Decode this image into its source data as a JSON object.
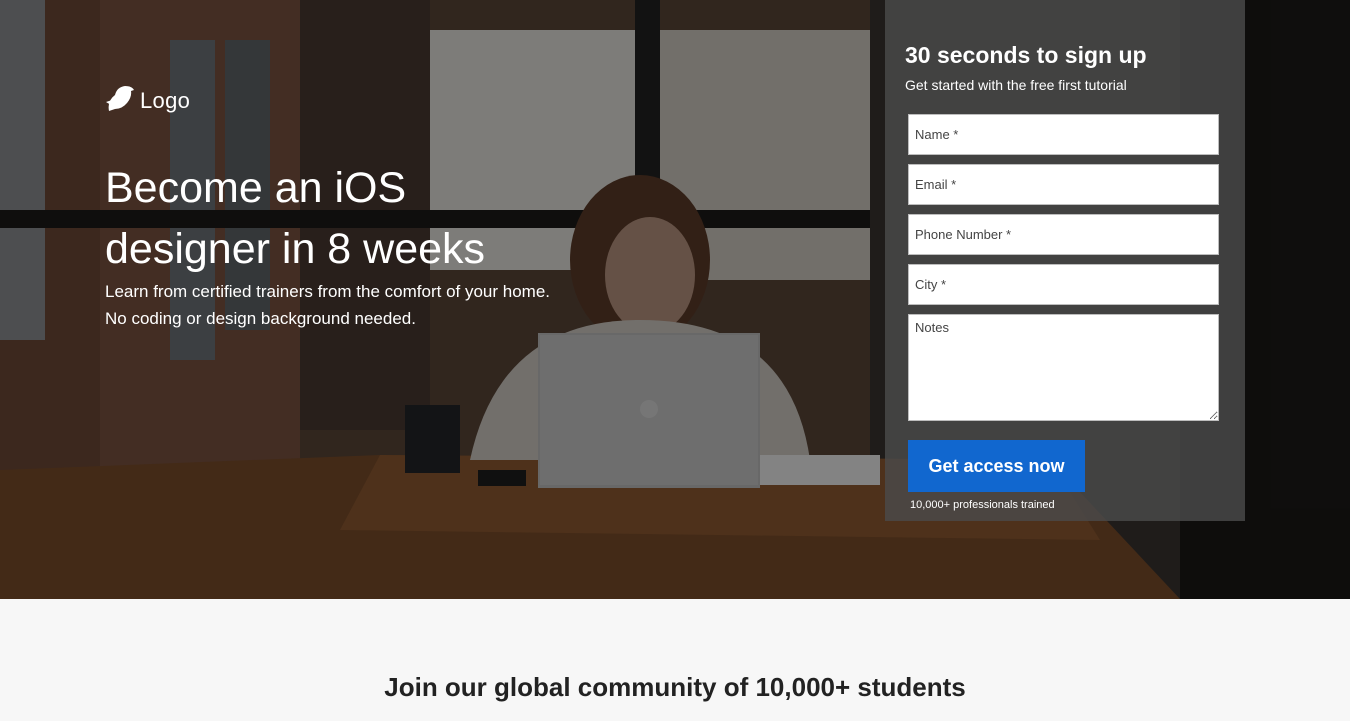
{
  "brand": {
    "logo_text": "Logo",
    "logo_icon": "bird-icon",
    "accent_color": "#1167cf"
  },
  "hero": {
    "headline": "Become an iOS designer in 8 weeks",
    "subline_1": "Learn from certified trainers from the comfort of your home.",
    "subline_2": "No coding or design background needed."
  },
  "form": {
    "title": "30 seconds to sign up",
    "subtitle": "Get started with the free first tutorial",
    "fields": [
      {
        "placeholder": "Name *",
        "value": ""
      },
      {
        "placeholder": "Email *",
        "value": ""
      },
      {
        "placeholder": "Phone Number *",
        "value": ""
      },
      {
        "placeholder": "City *",
        "value": ""
      },
      {
        "placeholder": "Notes",
        "value": ""
      }
    ],
    "submit_label": "Get access now",
    "trained_note": "10,000+ professionals trained"
  },
  "community": {
    "heading": "Join our global community of 10,000+ students"
  }
}
